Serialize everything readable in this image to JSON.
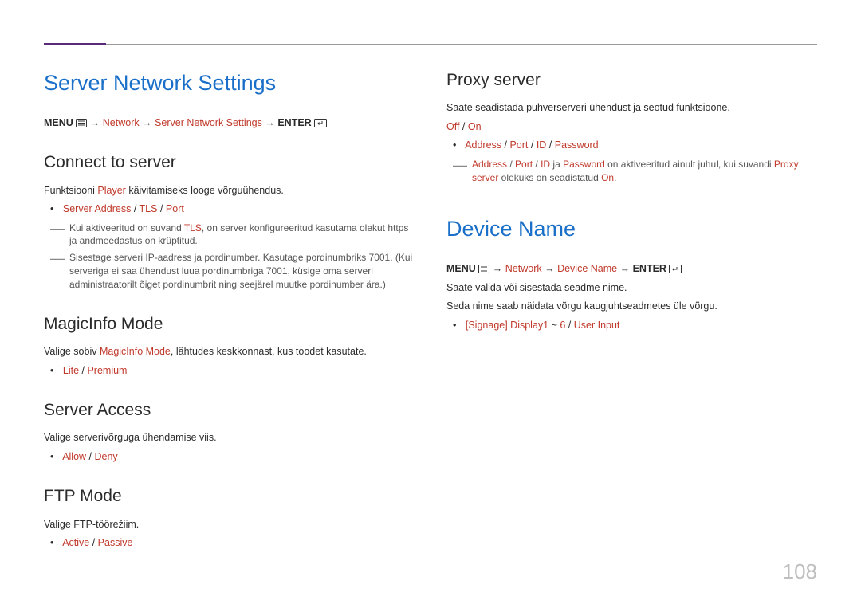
{
  "page_number": "108",
  "left": {
    "h1": "Server Network Settings",
    "breadcrumb": {
      "menu": "MENU",
      "arrow": "→",
      "network": "Network",
      "sns": "Server Network Settings",
      "enter": "ENTER"
    },
    "connect": {
      "title": "Connect to server",
      "para1_a": "Funktsiooni ",
      "para1_b": "Player",
      "para1_c": " käivitamiseks looge võrguühendus.",
      "bullet_sa": "Server Address",
      "bullet_tls": "TLS",
      "bullet_port": "Port",
      "note1_a": "Kui aktiveeritud on suvand ",
      "note1_b": "TLS",
      "note1_c": ", on server konfigureeritud kasutama olekut https ja andmeedastus on krüptitud.",
      "note2": "Sisestage serveri IP-aadress ja pordinumber. Kasutage pordinumbriks 7001. (Kui serveriga ei saa ühendust luua pordinumbriga 7001, küsige oma serveri administraatorilt õiget pordinumbrit ning seejärel muutke pordinumber ära.)"
    },
    "magicinfo": {
      "title": "MagicInfo Mode",
      "para_a": "Valige sobiv ",
      "para_b": "MagicInfo Mode",
      "para_c": ", lähtudes keskkonnast, kus toodet kasutate.",
      "opt_lite": "Lite",
      "opt_premium": "Premium"
    },
    "access": {
      "title": "Server Access",
      "para": "Valige serverivõrguga ühendamise viis.",
      "opt_allow": "Allow",
      "opt_deny": "Deny"
    },
    "ftp": {
      "title": "FTP Mode",
      "para": "Valige FTP-töörežiim.",
      "opt_active": "Active",
      "opt_passive": "Passive"
    }
  },
  "right": {
    "proxy": {
      "title": "Proxy server",
      "para": "Saate seadistada puhverserveri ühendust ja seotud funktsioone.",
      "opt_off": "Off",
      "opt_on": "On",
      "opt_address": "Address",
      "opt_port": "Port",
      "opt_id": "ID",
      "opt_password": "Password",
      "note_a": "Address",
      "note_b": "Port",
      "note_c": "ID",
      "note_d": " ja ",
      "note_e": "Password",
      "note_f": " on aktiveeritud ainult juhul, kui suvandi ",
      "note_g": "Proxy server",
      "note_h": " olekuks on seadistatud ",
      "note_i": "On",
      "note_j": "."
    },
    "device": {
      "h1": "Device Name",
      "breadcrumb": {
        "menu": "MENU",
        "arrow": "→",
        "network": "Network",
        "dn": "Device Name",
        "enter": "ENTER"
      },
      "para1": "Saate valida või sisestada seadme nime.",
      "para2": "Seda nime saab näidata võrgu kaugjuhtseadmetes üle võrgu.",
      "opt_a": "[Signage] Display1",
      "opt_b": "6",
      "opt_c": "User Input",
      "tilde": " ~ "
    }
  },
  "sep": " / "
}
